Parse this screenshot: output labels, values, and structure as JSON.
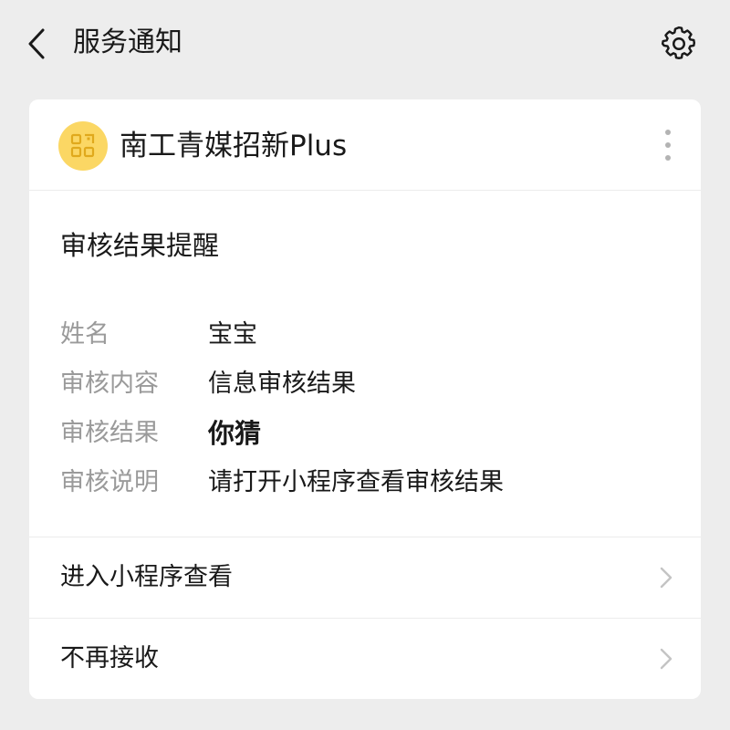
{
  "header": {
    "title": "服务通知",
    "back_icon": "chevron-left-icon",
    "settings_icon": "gear-icon"
  },
  "card": {
    "mini_program": {
      "name": "南工青媒招新Plus",
      "avatar_color": "#fbd764",
      "avatar_icon": "qr-code-icon",
      "more_icon": "more-vertical-icon"
    },
    "notice_title": "审核结果提醒",
    "fields": [
      {
        "label": "姓名",
        "value": "宝宝"
      },
      {
        "label": "审核内容",
        "value": "信息审核结果"
      },
      {
        "label": "审核结果",
        "value": "你猜"
      },
      {
        "label": "审核说明",
        "value": "请打开小程序查看审核结果"
      }
    ],
    "actions": [
      {
        "label": "进入小程序查看"
      },
      {
        "label": "不再接收"
      }
    ]
  },
  "colors": {
    "background": "#ededed",
    "card": "#ffffff",
    "label_gray": "#9a9a9a",
    "text": "#191919"
  }
}
